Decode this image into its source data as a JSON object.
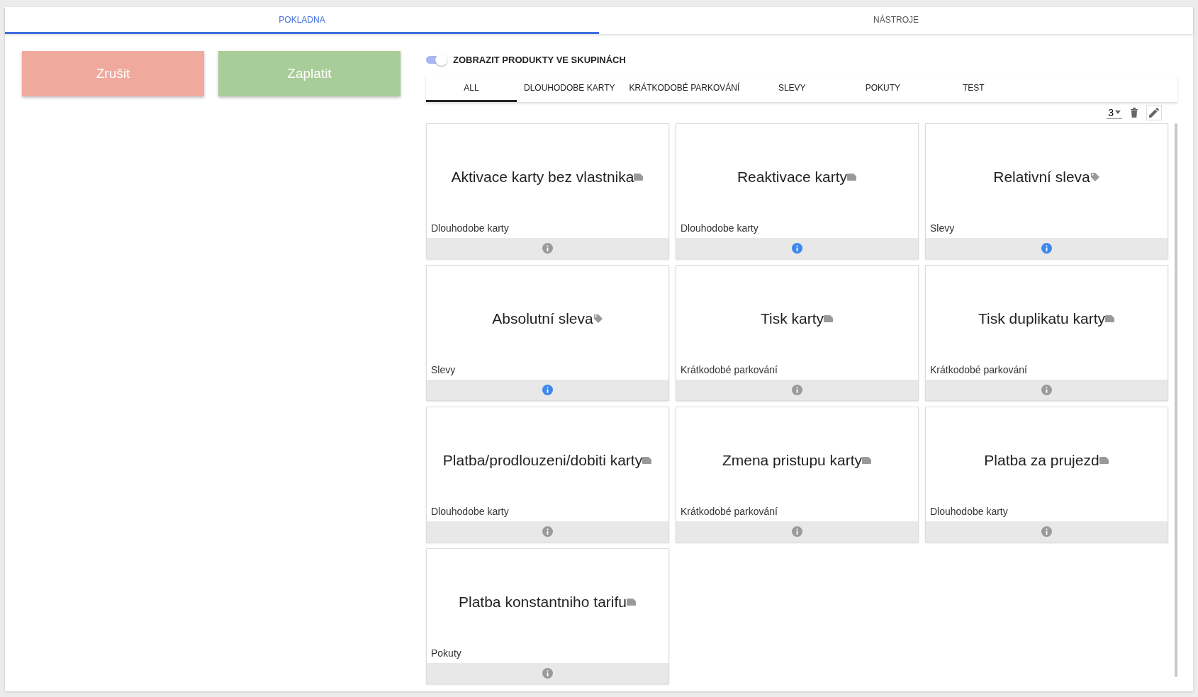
{
  "main_tabs": [
    {
      "label": "POKLADNA",
      "selected": true
    },
    {
      "label": "NÁSTROJE",
      "selected": false
    }
  ],
  "actions": {
    "cancel": "Zrušit",
    "pay": "Zaplatit"
  },
  "group_toggle": {
    "label": "ZOBRAZIT PRODUKTY VE SKUPINÁCH",
    "on": true
  },
  "category_tabs": [
    {
      "label": "ALL",
      "selected": true
    },
    {
      "label": "DLOUHODOBE KARTY",
      "selected": false
    },
    {
      "label": "KRÁTKODOBÉ PARKOVÁNÍ",
      "selected": false
    },
    {
      "label": "SLEVY",
      "selected": false
    },
    {
      "label": "POKUTY",
      "selected": false
    },
    {
      "label": "TEST",
      "selected": false
    }
  ],
  "columns_select": {
    "value": "3"
  },
  "products": [
    {
      "name": "Aktivace karty bez vlastnika",
      "kind": "card",
      "category": "Dlouhodobe karty",
      "info_highlighted": false
    },
    {
      "name": "Reaktivace karty",
      "kind": "card",
      "category": "Dlouhodobe karty",
      "info_highlighted": true
    },
    {
      "name": "Relativní sleva",
      "kind": "tag",
      "category": "Slevy",
      "info_highlighted": true
    },
    {
      "name": "Absolutní sleva",
      "kind": "tag",
      "category": "Slevy",
      "info_highlighted": true
    },
    {
      "name": "Tisk karty",
      "kind": "card",
      "category": "Krátkodobé parkování",
      "info_highlighted": false
    },
    {
      "name": "Tisk duplikatu karty",
      "kind": "card",
      "category": "Krátkodobé parkování",
      "info_highlighted": false
    },
    {
      "name": "Platba/prodlouzeni/dobiti karty",
      "kind": "card",
      "category": "Dlouhodobe karty",
      "info_highlighted": false
    },
    {
      "name": "Zmena pristupu karty",
      "kind": "card",
      "category": "Krátkodobé parkování",
      "info_highlighted": false
    },
    {
      "name": "Platba za prujezd",
      "kind": "card",
      "category": "Dlouhodobe karty",
      "info_highlighted": false
    },
    {
      "name": "Platba konstantniho tarifu",
      "kind": "card",
      "category": "Pokuty",
      "info_highlighted": false
    }
  ]
}
